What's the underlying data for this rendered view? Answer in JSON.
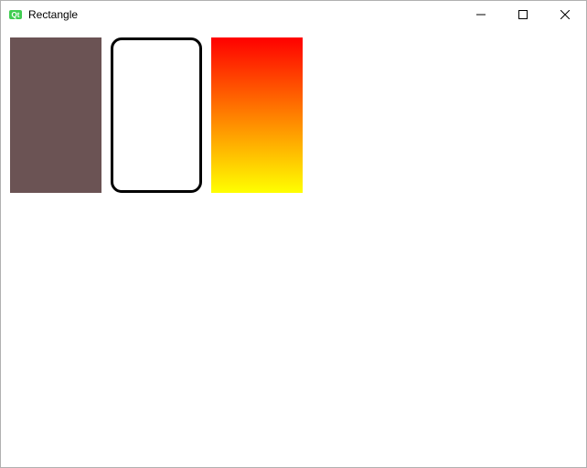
{
  "window": {
    "title": "Rectangle",
    "app_icon_color": "#41cd52"
  },
  "rects": {
    "solid": {
      "fill": "#6b5354"
    },
    "outline": {
      "border_color": "#000000",
      "border_width_px": 3,
      "radius_px": 12
    },
    "gradient": {
      "top_color": "#ff0000",
      "bottom_color": "#ffff00"
    }
  }
}
